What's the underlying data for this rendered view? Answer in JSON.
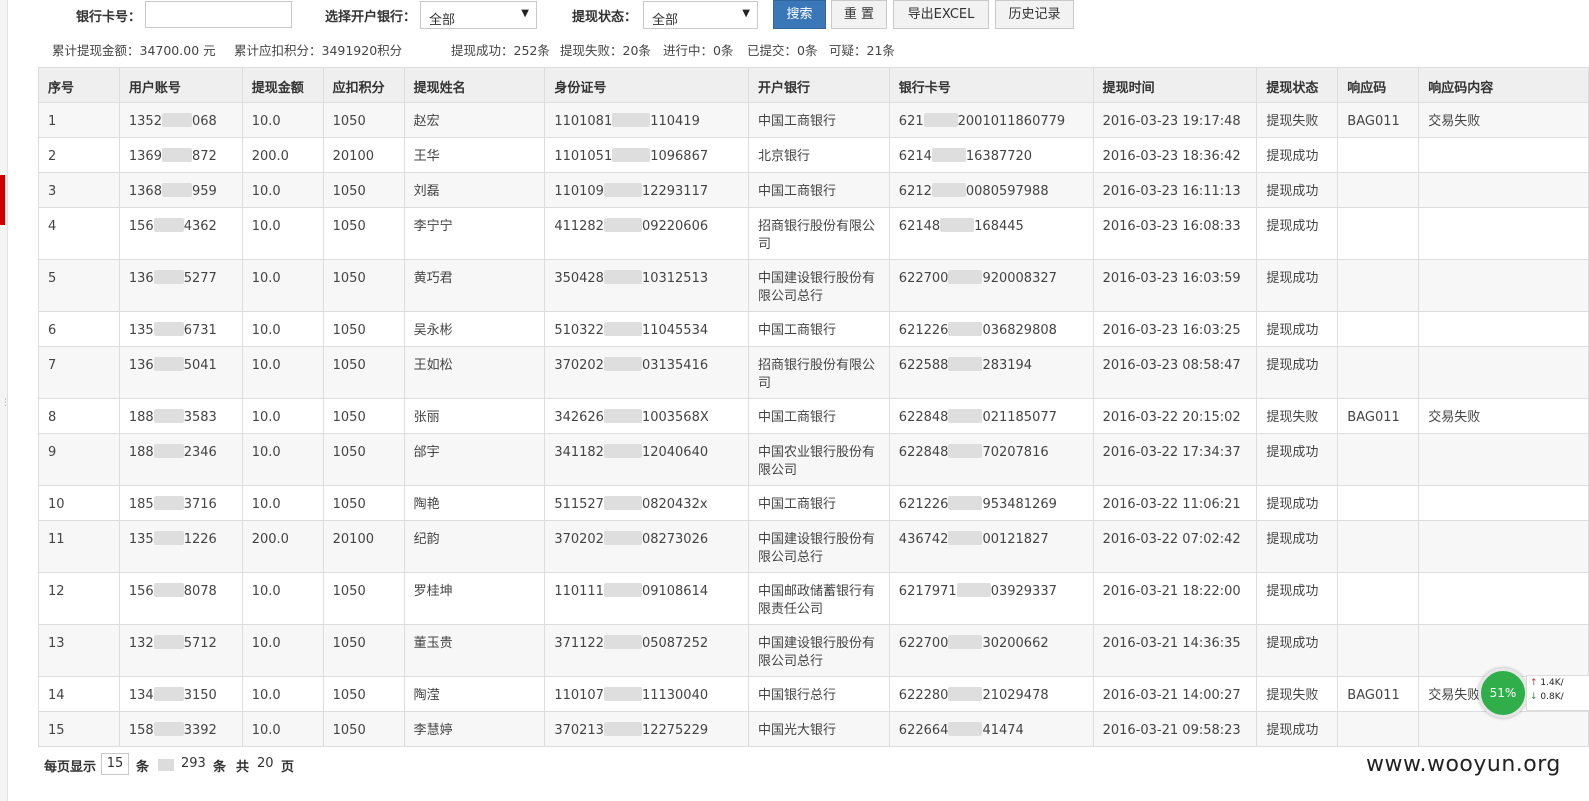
{
  "filters": {
    "card_label": "银行卡号：",
    "card_value": "",
    "bank_label": "选择开户银行：",
    "bank_value": "全部",
    "status_label": "提现状态：",
    "status_value": "全部",
    "dropdown_arrow": "▼"
  },
  "buttons": {
    "search": "搜索",
    "reset": "重 置",
    "export": "导出EXCEL",
    "history": "历史记录"
  },
  "summary": {
    "total_amount": "累计提现金额：34700.00 元",
    "total_points": "累计应扣积分：3491920积分",
    "success": "提现成功：252条",
    "failed": "提现失败：20条",
    "in_progress": "进行中：0条",
    "submitted": "已提交：0条",
    "suspicious": "可疑：21条"
  },
  "table": {
    "headers": [
      "序号",
      "用户账号",
      "提现金额",
      "应扣积分",
      "提现姓名",
      "身份证号",
      "开户银行",
      "银行卡号",
      "提现时间",
      "提现状态",
      "响应码",
      "响应码内容"
    ],
    "rows": [
      [
        "1",
        "1352",
        "068",
        "10.0",
        "1050",
        "赵宏",
        "1101081",
        "110419",
        "中国工商银行",
        "621",
        "2001011860779",
        "2016-03-23 19:17:48",
        "提现失败",
        "BAG011",
        "交易失败"
      ],
      [
        "2",
        "1369",
        "872",
        "200.0",
        "20100",
        "王华",
        "1101051",
        "1096867",
        "北京银行",
        "6214",
        "16387720",
        "2016-03-23 18:36:42",
        "提现成功",
        "",
        ""
      ],
      [
        "3",
        "1368",
        "959",
        "10.0",
        "1050",
        "刘磊",
        "110109",
        "12293117",
        "中国工商银行",
        "6212",
        "0080597988",
        "2016-03-23 16:11:13",
        "提现成功",
        "",
        ""
      ],
      [
        "4",
        "156",
        "4362",
        "10.0",
        "1050",
        "李宁宁",
        "411282",
        "09220606",
        "招商银行股份有限公司",
        "62148",
        "168445",
        "2016-03-23 16:08:33",
        "提现成功",
        "",
        ""
      ],
      [
        "5",
        "136",
        "5277",
        "10.0",
        "1050",
        "黄巧君",
        "350428",
        "10312513",
        "中国建设银行股份有限公司总行",
        "622700",
        "920008327",
        "2016-03-23 16:03:59",
        "提现成功",
        "",
        ""
      ],
      [
        "6",
        "135",
        "6731",
        "10.0",
        "1050",
        "吴永彬",
        "510322",
        "11045534",
        "中国工商银行",
        "621226",
        "036829808",
        "2016-03-23 16:03:25",
        "提现成功",
        "",
        ""
      ],
      [
        "7",
        "136",
        "5041",
        "10.0",
        "1050",
        "王如松",
        "370202",
        "03135416",
        "招商银行股份有限公司",
        "622588",
        "283194",
        "2016-03-23 08:58:47",
        "提现成功",
        "",
        ""
      ],
      [
        "8",
        "188",
        "3583",
        "10.0",
        "1050",
        "张丽",
        "342626",
        "1003568X",
        "中国工商银行",
        "622848",
        "021185077",
        "2016-03-22 20:15:02",
        "提现失败",
        "BAG011",
        "交易失败"
      ],
      [
        "9",
        "188",
        "2346",
        "10.0",
        "1050",
        "邰宇",
        "341182",
        "12040640",
        "中国农业银行股份有限公司",
        "622848",
        "70207816",
        "2016-03-22 17:34:37",
        "提现成功",
        "",
        ""
      ],
      [
        "10",
        "185",
        "3716",
        "10.0",
        "1050",
        "陶艳",
        "511527",
        "0820432x",
        "中国工商银行",
        "621226",
        "953481269",
        "2016-03-22 11:06:21",
        "提现成功",
        "",
        ""
      ],
      [
        "11",
        "135",
        "1226",
        "200.0",
        "20100",
        "纪韵",
        "370202",
        "08273026",
        "中国建设银行股份有限公司总行",
        "436742",
        "00121827",
        "2016-03-22 07:02:42",
        "提现成功",
        "",
        ""
      ],
      [
        "12",
        "156",
        "8078",
        "10.0",
        "1050",
        "罗桂坤",
        "110111",
        "09108614",
        "中国邮政储蓄银行有限责任公司",
        "6217971",
        "03929337",
        "2016-03-21 18:22:00",
        "提现成功",
        "",
        ""
      ],
      [
        "13",
        "132",
        "5712",
        "10.0",
        "1050",
        "董玉贵",
        "371122",
        "05087252",
        "中国建设银行股份有限公司总行",
        "622700",
        "30200662",
        "2016-03-21 14:36:35",
        "提现成功",
        "",
        ""
      ],
      [
        "14",
        "134",
        "3150",
        "10.0",
        "1050",
        "陶滢",
        "110107",
        "11130040",
        "中国银行总行",
        "622280",
        "21029478",
        "2016-03-21 14:00:27",
        "提现失败",
        "BAG011",
        "交易失败"
      ],
      [
        "15",
        "158",
        "3392",
        "10.0",
        "1050",
        "李慧婷",
        "370213",
        "12275229",
        "中国光大银行",
        "622664",
        "41474",
        "2016-03-21 09:58:23",
        "提现成功",
        "",
        ""
      ]
    ]
  },
  "pager": {
    "per_page_label": "每页显示",
    "per_page_value": "15",
    "unit_1": "条",
    "total_count": "293",
    "unit_2": "条",
    "total_label": "共",
    "total_pages": "20",
    "page_unit": "页"
  },
  "speed_widget": {
    "percent": "51%",
    "up": "1.4K/",
    "down": "0.8K/",
    "up_arrow": "↑",
    "down_arrow": "↓"
  },
  "watermark": "www.wooyun.org",
  "colors": {
    "primary_button": "#3a77b8",
    "header_bg": "#efefef",
    "stripe": "#f7f7f7",
    "speed_ball": "#2fae4a"
  }
}
